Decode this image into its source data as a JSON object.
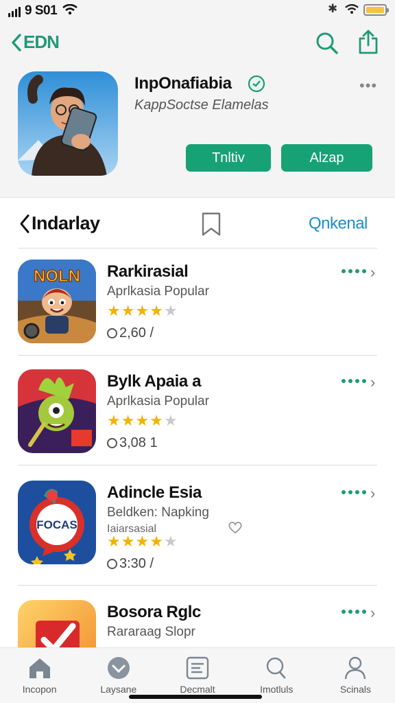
{
  "status_bar": {
    "time": "9 S01"
  },
  "nav": {
    "back_label": "EDN"
  },
  "app": {
    "name": "InpOnafiabia",
    "subtitle": "KappSoctse Elamelas",
    "primary_button": "Tnltiv",
    "secondary_button": "Alzap"
  },
  "section": {
    "title": "Indarlay",
    "link": "Qnkenal"
  },
  "list": [
    {
      "title": "Rarkirasial",
      "subtitle": "Aprlkasia Popular",
      "rating": 4,
      "count": "2,60 /"
    },
    {
      "title": "Bylk Apaia a",
      "subtitle": "Aprlkasia Popular",
      "rating": 4,
      "count": "3,08 1"
    },
    {
      "title": "Adincle Esia",
      "subtitle": "Beldken: Napking",
      "subtitle2": "Iaiarsasial",
      "rating": 4,
      "count": "3:30 /"
    },
    {
      "title": "Bosora Rglc",
      "subtitle": "Rararaag Slopr"
    }
  ],
  "thumb_text": {
    "row1": "NOLN",
    "row3": "FOCAS"
  },
  "tabs": [
    {
      "label": "Incopon",
      "icon": "home-icon"
    },
    {
      "label": "Laysane",
      "icon": "heart-icon"
    },
    {
      "label": "Decmalt",
      "icon": "document-icon"
    },
    {
      "label": "Imotluls",
      "icon": "search-icon"
    },
    {
      "label": "Scinals",
      "icon": "person-icon"
    }
  ],
  "colors": {
    "accent_green": "#16a274",
    "link_blue": "#1a8fd0",
    "star": "#f0b400"
  }
}
